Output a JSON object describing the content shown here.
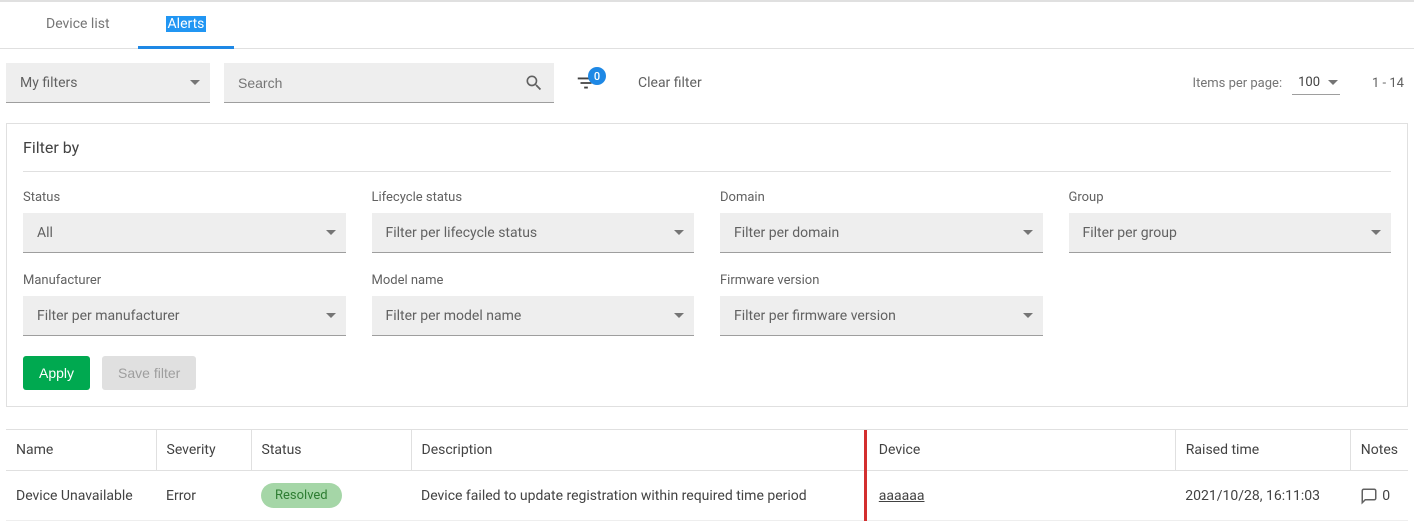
{
  "tabs": {
    "device_list": "Device list",
    "alerts": "Alerts"
  },
  "toolbar": {
    "my_filters": "My filters",
    "search_placeholder": "Search",
    "badge_count": "0",
    "clear_filter": "Clear filter",
    "items_per_page_label": "Items per page:",
    "items_per_page_value": "100",
    "range": "1 - 14"
  },
  "filter": {
    "title": "Filter by",
    "status_label": "Status",
    "status_value": "All",
    "lifecycle_label": "Lifecycle status",
    "lifecycle_value": "Filter per lifecycle status",
    "domain_label": "Domain",
    "domain_value": "Filter per domain",
    "group_label": "Group",
    "group_value": "Filter per group",
    "manufacturer_label": "Manufacturer",
    "manufacturer_value": "Filter per manufacturer",
    "model_label": "Model name",
    "model_value": "Filter per model name",
    "firmware_label": "Firmware version",
    "firmware_value": "Filter per firmware version",
    "apply": "Apply",
    "save_filter": "Save filter"
  },
  "table": {
    "headers": {
      "name": "Name",
      "severity": "Severity",
      "status": "Status",
      "description": "Description",
      "device": "Device",
      "raised_time": "Raised time",
      "notes": "Notes"
    },
    "row": {
      "name": "Device Unavailable",
      "severity": "Error",
      "status": "Resolved",
      "description": "Device failed to update registration within required time period",
      "device": "aaaaaa",
      "raised_time": "2021/10/28, 16:11:03",
      "notes_count": "0"
    }
  }
}
